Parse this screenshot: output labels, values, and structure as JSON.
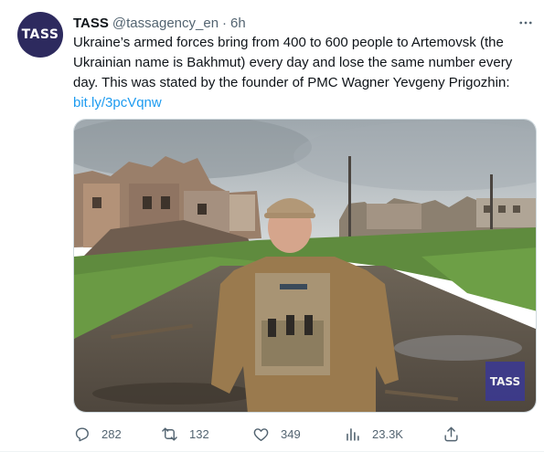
{
  "tweet": {
    "author_name": "TASS",
    "handle": "@tassagency_en",
    "separator": "·",
    "time": "6h",
    "avatar_text": "TASS",
    "text": "Ukraine’s armed forces bring from 400 to 600 people to Artemovsk (the Ukrainian name is Bakhmut) every day and lose the same number every day. This was stated by the founder of PMC Wagner Yevgeny Prigozhin:",
    "link": "bit.ly/3pcVqnw",
    "media_watermark": "TASS"
  },
  "actions": {
    "replies": "282",
    "retweets": "132",
    "likes": "349",
    "views": "23.3K"
  },
  "icons": {
    "more": "more-horizontal-icon",
    "reply": "reply-icon",
    "retweet": "retweet-icon",
    "like": "heart-icon",
    "views": "views-chart-icon",
    "share": "share-icon"
  },
  "colors": {
    "avatar_bg": "#2d2a5e",
    "link": "#1d9bf0",
    "secondary_text": "#536471",
    "watermark_bg": "#3c3a8f"
  }
}
